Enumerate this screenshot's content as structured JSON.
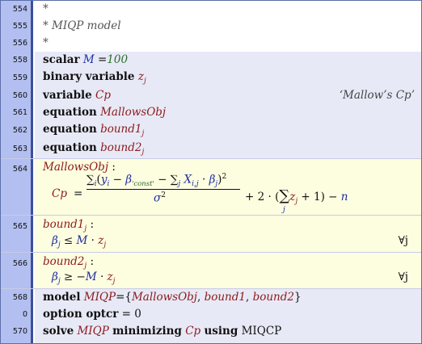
{
  "lines": {
    "l554": {
      "num": "554",
      "text": "*"
    },
    "l555": {
      "num": "555",
      "text": "* MIQP model"
    },
    "l556": {
      "num": "556",
      "text": "*"
    },
    "l558": {
      "num": "558",
      "kw": "scalar",
      "var": "M",
      "eq": "=",
      "val": "100"
    },
    "l559": {
      "num": "559",
      "kw": "binary variable",
      "var": "z",
      "sub": "j"
    },
    "l560": {
      "num": "560",
      "kw": "variable",
      "var": "Cp",
      "desc": "‘Mallow’s Cp’"
    },
    "l561": {
      "num": "561",
      "kw": "equation",
      "var": "MallowsObj"
    },
    "l562": {
      "num": "562",
      "kw": "equation",
      "var": "bound1",
      "sub": "j"
    },
    "l563": {
      "num": "563",
      "kw": "equation",
      "var": "bound2",
      "sub": "j"
    },
    "l564": {
      "num": "564",
      "name": "MallowsObj",
      "colon": ":",
      "lhs": "Cp",
      "eq": "=",
      "sigma": "∑",
      "i": "i",
      "y": "y",
      "beta": "β",
      "const": "'const'",
      "minus": "−",
      "j": "j",
      "X": "X",
      "ij": "i,j",
      "dot": "·",
      "sq": "2",
      "sigma_den": "σ",
      "tail1": "+ 2 · (",
      "tail2": "+ 1) −",
      "n": "n"
    },
    "l565": {
      "num": "565",
      "name": "bound1",
      "sub": "j",
      "colon": ":",
      "beta": "β",
      "rel": "≤",
      "M": "M",
      "z": "z",
      "forall": "∀j"
    },
    "l566": {
      "num": "566",
      "name": "bound2",
      "sub": "j",
      "colon": ":",
      "beta": "β",
      "rel": "≥ −",
      "M": "M",
      "z": "z",
      "forall": "∀j"
    },
    "l568": {
      "num": "568",
      "kw": "model",
      "name": "MIQP",
      "rest_open": "={",
      "a": "MallowsObj",
      "b": "bound1",
      "c": "bound2",
      "rest_close": "}"
    },
    "l0": {
      "num": "0",
      "kw": "option optcr",
      "eq": "= 0"
    },
    "l570": {
      "num": "570",
      "kw1": "solve",
      "name": "MIQP",
      "kw2": "minimizing",
      "var": "Cp",
      "kw3": "using",
      "solver": "MIQCP"
    }
  }
}
